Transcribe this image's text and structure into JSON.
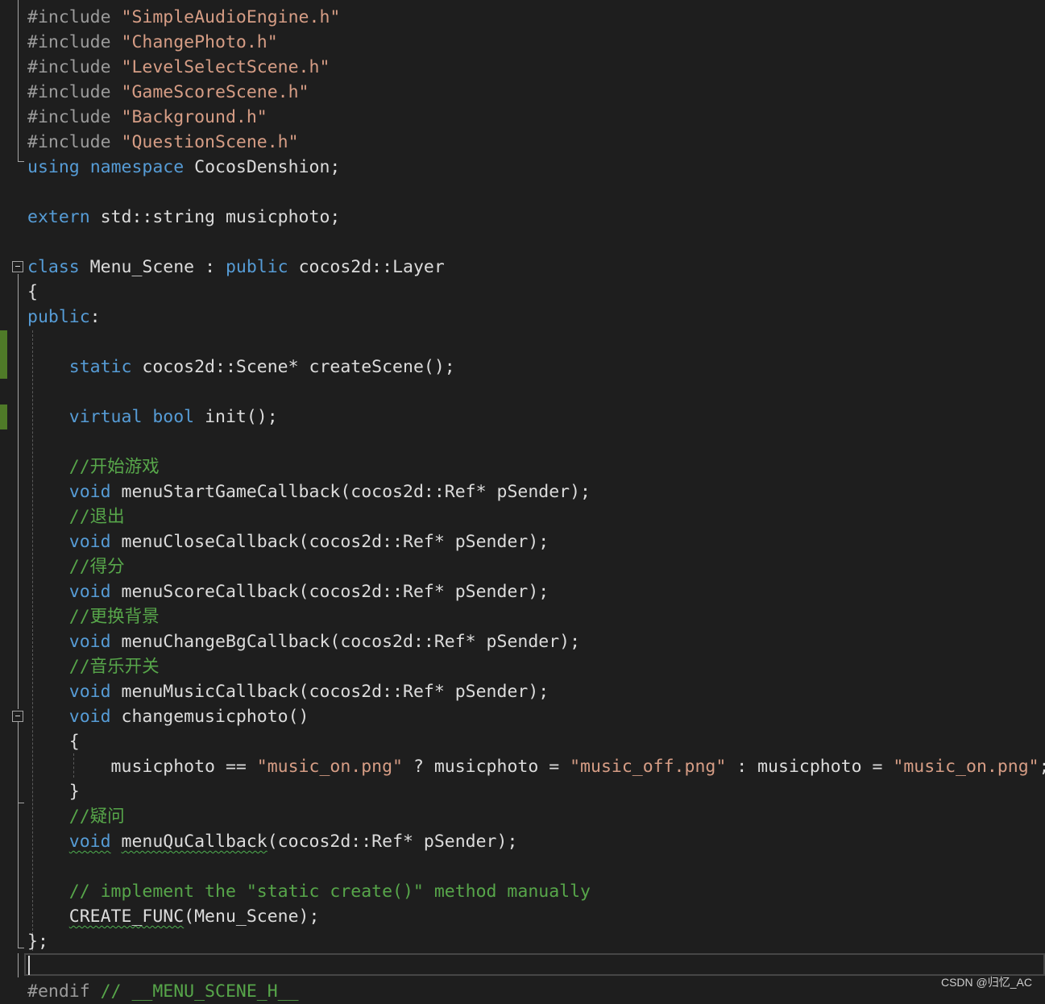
{
  "editor": {
    "lines": [
      [
        {
          "t": "#include ",
          "c": "pre"
        },
        {
          "t": "\"SimpleAudioEngine.h\"",
          "c": "str"
        }
      ],
      [
        {
          "t": "#include ",
          "c": "pre"
        },
        {
          "t": "\"ChangePhoto.h\"",
          "c": "str"
        }
      ],
      [
        {
          "t": "#include ",
          "c": "pre"
        },
        {
          "t": "\"LevelSelectScene.h\"",
          "c": "str"
        }
      ],
      [
        {
          "t": "#include ",
          "c": "pre"
        },
        {
          "t": "\"GameScoreScene.h\"",
          "c": "str"
        }
      ],
      [
        {
          "t": "#include ",
          "c": "pre"
        },
        {
          "t": "\"Background.h\"",
          "c": "str"
        }
      ],
      [
        {
          "t": "#include ",
          "c": "pre"
        },
        {
          "t": "\"QuestionScene.h\"",
          "c": "str"
        }
      ],
      [
        {
          "t": "using",
          "c": "kw"
        },
        {
          "t": " ",
          "c": "txt"
        },
        {
          "t": "namespace",
          "c": "kw"
        },
        {
          "t": " CocosDenshion;",
          "c": "txt"
        }
      ],
      [],
      [
        {
          "t": "extern",
          "c": "kw"
        },
        {
          "t": " std::string musicphoto;",
          "c": "txt"
        }
      ],
      [],
      [
        {
          "t": "class",
          "c": "kw"
        },
        {
          "t": " Menu_Scene : ",
          "c": "txt"
        },
        {
          "t": "public",
          "c": "kw"
        },
        {
          "t": " cocos2d::Layer",
          "c": "txt"
        }
      ],
      [
        {
          "t": "{",
          "c": "txt"
        }
      ],
      [
        {
          "t": "public",
          "c": "kw"
        },
        {
          "t": ":",
          "c": "txt"
        }
      ],
      [],
      [
        {
          "t": "    ",
          "c": "txt"
        },
        {
          "t": "static",
          "c": "kw"
        },
        {
          "t": " cocos2d::Scene* createScene();",
          "c": "txt"
        }
      ],
      [],
      [
        {
          "t": "    ",
          "c": "txt"
        },
        {
          "t": "virtual",
          "c": "kw"
        },
        {
          "t": " ",
          "c": "txt"
        },
        {
          "t": "bool",
          "c": "kw"
        },
        {
          "t": " init();",
          "c": "txt"
        }
      ],
      [],
      [
        {
          "t": "    //开始游戏",
          "c": "cm"
        }
      ],
      [
        {
          "t": "    ",
          "c": "txt"
        },
        {
          "t": "void",
          "c": "kw"
        },
        {
          "t": " menuStartGameCallback(cocos2d::Ref* pSender);",
          "c": "txt"
        }
      ],
      [
        {
          "t": "    //退出",
          "c": "cm"
        }
      ],
      [
        {
          "t": "    ",
          "c": "txt"
        },
        {
          "t": "void",
          "c": "kw"
        },
        {
          "t": " menuCloseCallback(cocos2d::Ref* pSender);",
          "c": "txt"
        }
      ],
      [
        {
          "t": "    //得分",
          "c": "cm"
        }
      ],
      [
        {
          "t": "    ",
          "c": "txt"
        },
        {
          "t": "void",
          "c": "kw"
        },
        {
          "t": " menuScoreCallback(cocos2d::Ref* pSender);",
          "c": "txt"
        }
      ],
      [
        {
          "t": "    //更换背景",
          "c": "cm"
        }
      ],
      [
        {
          "t": "    ",
          "c": "txt"
        },
        {
          "t": "void",
          "c": "kw"
        },
        {
          "t": " menuChangeBgCallback(cocos2d::Ref* pSender);",
          "c": "txt"
        }
      ],
      [
        {
          "t": "    //音乐开关",
          "c": "cm"
        }
      ],
      [
        {
          "t": "    ",
          "c": "txt"
        },
        {
          "t": "void",
          "c": "kw"
        },
        {
          "t": " menuMusicCallback(cocos2d::Ref* pSender);",
          "c": "txt"
        }
      ],
      [
        {
          "t": "    ",
          "c": "txt"
        },
        {
          "t": "void",
          "c": "kw"
        },
        {
          "t": " changemusicphoto()",
          "c": "txt"
        }
      ],
      [
        {
          "t": "    {",
          "c": "txt"
        }
      ],
      [
        {
          "t": "        musicphoto == ",
          "c": "txt"
        },
        {
          "t": "\"music_on.png\"",
          "c": "str"
        },
        {
          "t": " ? musicphoto = ",
          "c": "txt"
        },
        {
          "t": "\"music_off.png\"",
          "c": "str"
        },
        {
          "t": " : musicphoto = ",
          "c": "txt"
        },
        {
          "t": "\"music_on.png\"",
          "c": "str"
        },
        {
          "t": ";",
          "c": "txt"
        }
      ],
      [
        {
          "t": "    }",
          "c": "txt"
        }
      ],
      [
        {
          "t": "    //疑问",
          "c": "cm"
        }
      ],
      [
        {
          "t": "    ",
          "c": "txt"
        },
        {
          "t": "void",
          "c": "kw sq"
        },
        {
          "t": " ",
          "c": "txt"
        },
        {
          "t": "menuQuCallback",
          "c": "txt sq"
        },
        {
          "t": "(cocos2d::Ref* pSender);",
          "c": "txt"
        }
      ],
      [],
      [
        {
          "t": "    // implement the \"static create()\" method manually",
          "c": "cm"
        }
      ],
      [
        {
          "t": "    ",
          "c": "txt"
        },
        {
          "t": "CREATE_FUNC",
          "c": "txt sq"
        },
        {
          "t": "(Menu_Scene);",
          "c": "txt"
        }
      ],
      [
        {
          "t": "};",
          "c": "txt"
        }
      ],
      [],
      [
        {
          "t": "#endif ",
          "c": "pre"
        },
        {
          "t": "// __MENU_SCENE_H__",
          "c": "cm"
        }
      ]
    ]
  },
  "watermark": "CSDN @归忆_AC"
}
